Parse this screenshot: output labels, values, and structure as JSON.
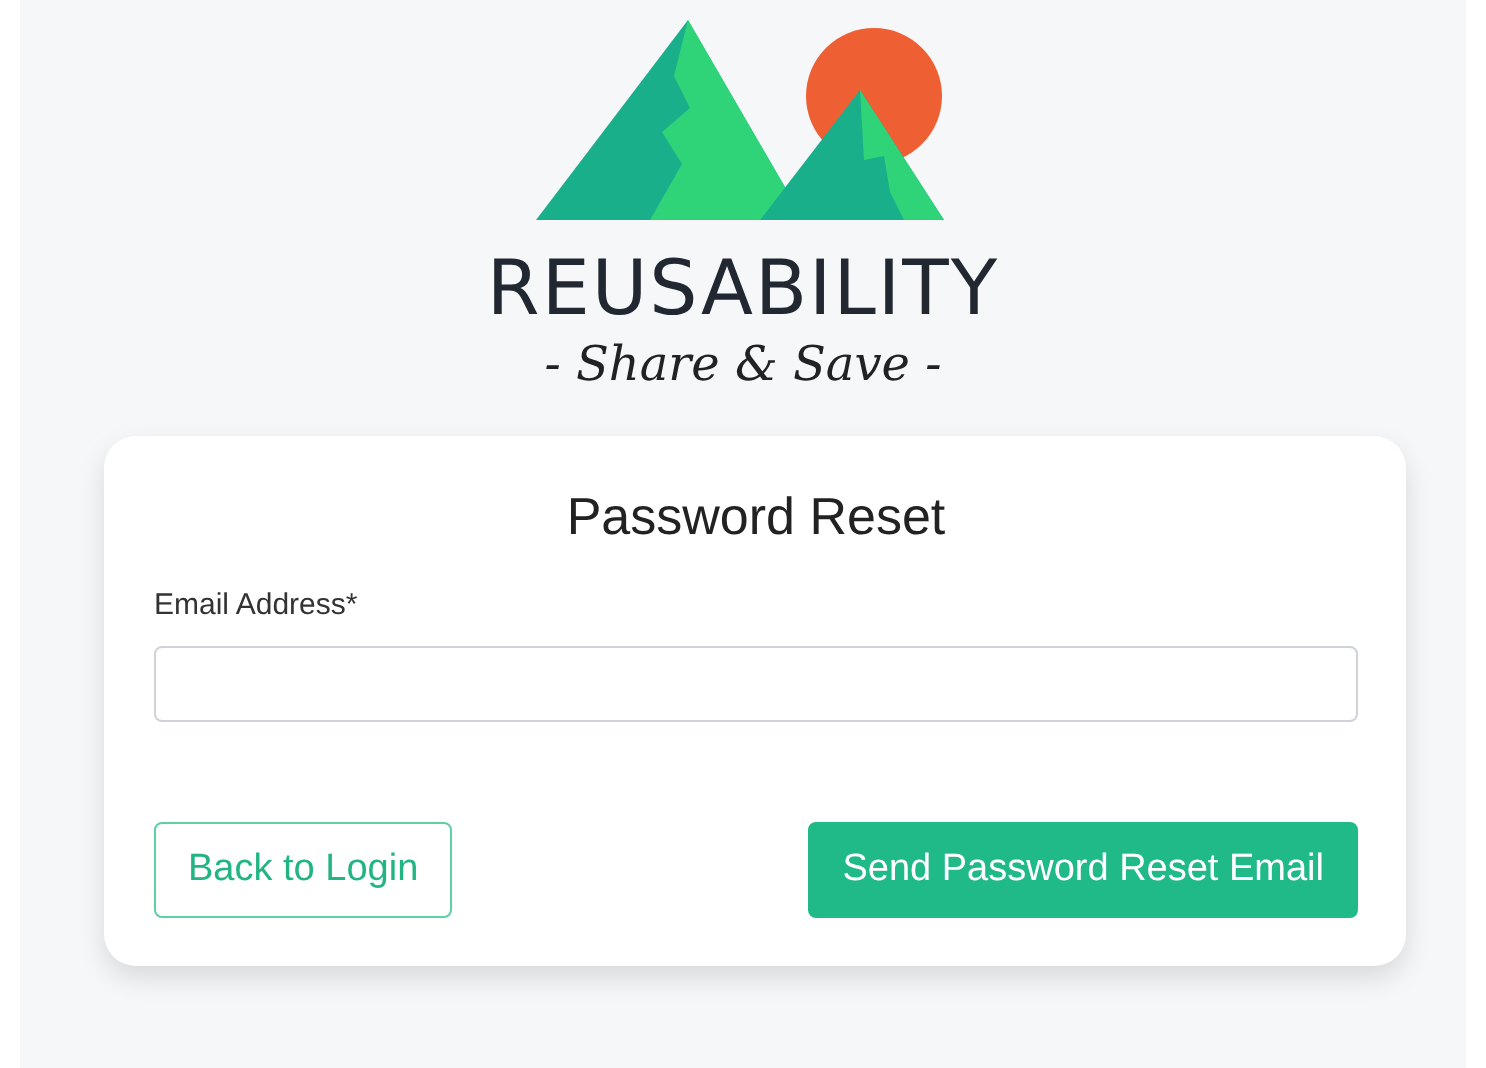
{
  "brand": {
    "name": "REUSABILITY",
    "tagline": "- Share & Save -"
  },
  "form": {
    "title": "Password Reset",
    "email_label": "Email Address*",
    "buttons": [
      {
        "label": "Back to Login",
        "kind": "outline"
      },
      {
        "label": "Send Password Reset Email",
        "kind": "primary"
      }
    ]
  }
}
